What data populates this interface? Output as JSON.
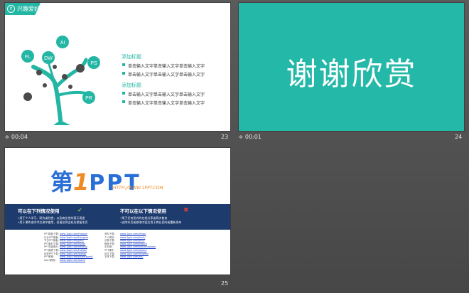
{
  "slides": [
    {
      "number": "23",
      "duration": "00:04",
      "header_title": "兴趣爱好",
      "header_logo": "r",
      "tree_labels": [
        "FL",
        "DW",
        "AI",
        "PS",
        "PR"
      ],
      "sections": [
        {
          "heading": "添加标题",
          "items": [
            "单击输入文字单击输入文字单击输入文字",
            "单击输入文字单击输入文字单击输入文字"
          ]
        },
        {
          "heading": "添加标题",
          "items": [
            "单击输入文字单击输入文字单击输入文字",
            "单击输入文字单击输入文字单击输入文字"
          ]
        }
      ]
    },
    {
      "number": "24",
      "duration": "00:01",
      "text": "谢谢欣赏"
    },
    {
      "number": "25",
      "logo_text": "第1PPT",
      "logo_first": "第",
      "logo_digit": "1",
      "logo_rest": "PPT",
      "url": "HTTP://WWW.1PPT.COM",
      "allowed": {
        "heading": "可以在下列情况使用",
        "lines": [
          "•用于个人学习、研究或欣赏，以及商业性的演示用途",
          "•用于课件或学术交流中使用，但请注明出处及保留本页"
        ]
      },
      "forbidden": {
        "heading": "不可以在以下情况使用",
        "lines": [
          "•用于任何形式的在线分享或再次售卖",
          "•去除本页或修改内容后用于商业目的或重新发布"
        ]
      },
      "links_left": [
        {
          "label": "PPT模板下载：",
          "url": "www.1ppt.com/moban/"
        },
        {
          "label": "行业PPT模板：",
          "url": "www.1ppt.com/hangye/"
        },
        {
          "label": "节日PPT模板：",
          "url": "www.1ppt.com/jieri/"
        },
        {
          "label": "PPT素材下载：",
          "url": "www.1ppt.com/sucai/"
        },
        {
          "label": "PPT背景图片：",
          "url": "www.1ppt.com/beijing/"
        },
        {
          "label": "PPT图表下载：",
          "url": "www.1ppt.com/tubiao/"
        },
        {
          "label": "优秀PPT下载：",
          "url": "www.1ppt.com/xiazai/"
        },
        {
          "label": "PPT教程：",
          "url": "www.1ppt.com/powerpoint/"
        },
        {
          "label": "Word教程：",
          "url": "www.1ppt.com/word/"
        }
      ],
      "links_right": [
        {
          "label": "资料下载：",
          "url": "www.1ppt.com/ziliao/"
        },
        {
          "label": "个人简历：",
          "url": "www.1ppt.com/jianli/"
        },
        {
          "label": "试卷下载：",
          "url": "www.1ppt.com/shiti/"
        },
        {
          "label": "教案下载：",
          "url": "www.1ppt.com/jiaoan/"
        },
        {
          "label": "手抄报：",
          "url": "www.1ppt.com/shouchaobao/"
        },
        {
          "label": "PPT课件：",
          "url": "www.1ppt.com/kejian/"
        },
        {
          "label": "范文下载：",
          "url": "www.1ppt.com/fanwen/"
        },
        {
          "label": "字体下载：",
          "url": "www.1ppt.com/ziti/"
        }
      ]
    }
  ],
  "colors": {
    "teal": "#24b6a4",
    "navy": "#1e3b6e",
    "logo_blue": "#2a6fd6",
    "logo_orange": "#f08a24"
  }
}
